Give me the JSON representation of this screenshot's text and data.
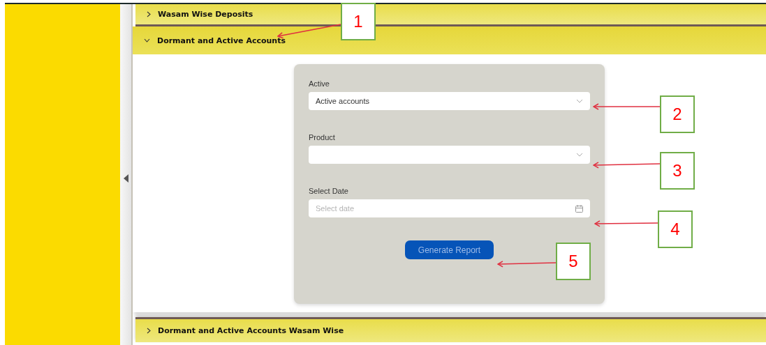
{
  "sections": [
    {
      "title": "Wasam Wise Deposits",
      "expanded": false
    },
    {
      "title": "Dormant and Active Accounts",
      "expanded": true,
      "form": {
        "fields": [
          {
            "kind": "select",
            "label": "Active",
            "value": "Active accounts"
          },
          {
            "kind": "select",
            "label": "Product"
          },
          {
            "kind": "date",
            "label": "Select Date",
            "placeholder": "Select date"
          }
        ],
        "button": {
          "label": "Generate Report",
          "disabled": true
        }
      }
    },
    {
      "title": "Dormant and Active Accounts Wasam Wise",
      "expanded": false
    }
  ],
  "callouts": [
    "1",
    "2",
    "3",
    "4",
    "5"
  ]
}
